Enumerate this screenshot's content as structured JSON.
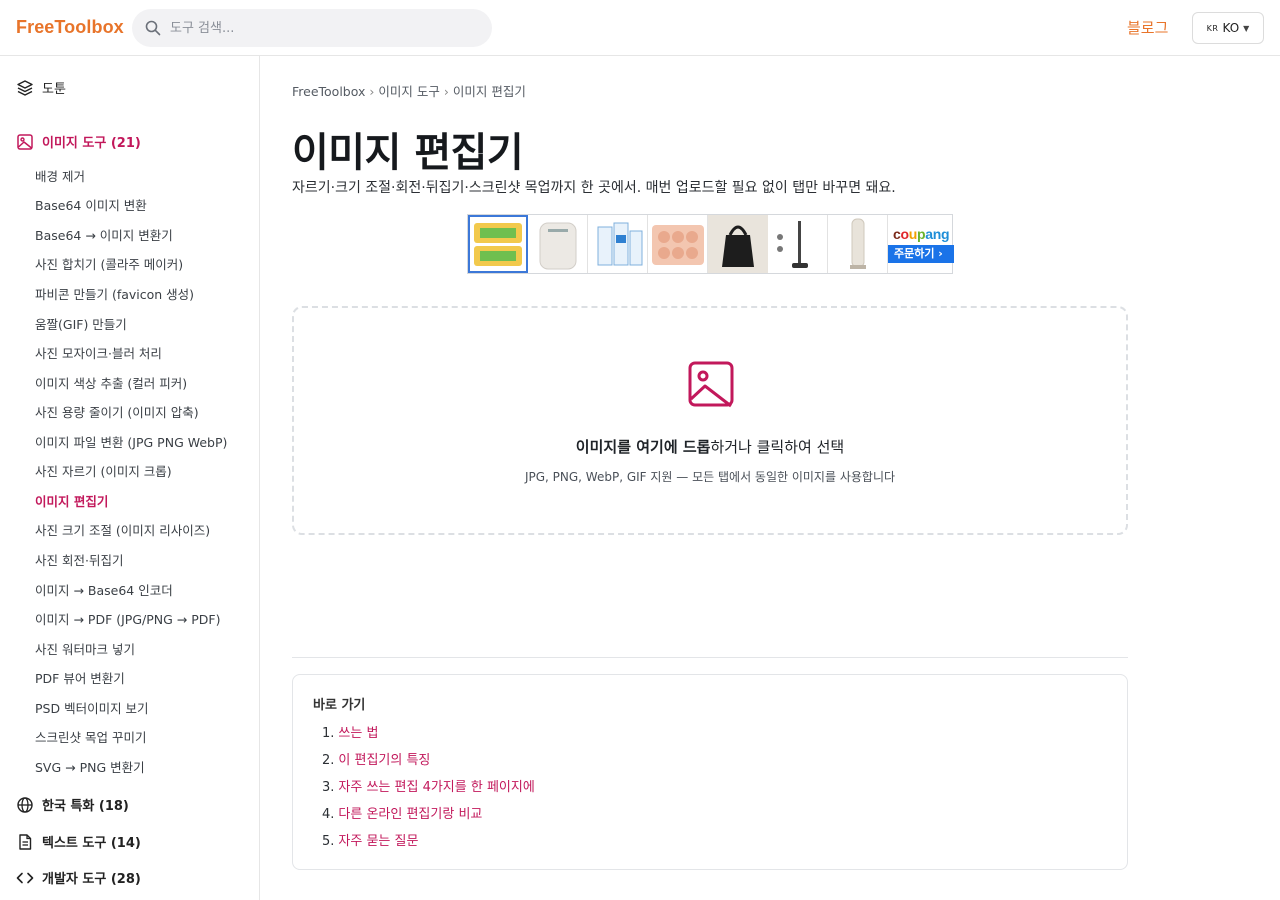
{
  "header": {
    "brand": "FreeToolbox",
    "search_placeholder": "도구 검색...",
    "blog_label": "블로그",
    "lang_flag": "KR",
    "lang_label": "KO"
  },
  "sidebar": {
    "top_item": "도툰",
    "categories": {
      "image": "이미지 도구 (21)",
      "korea": "한국 특화 (18)",
      "text": "텍스트 도구 (14)",
      "dev": "개발자 도구 (28)"
    },
    "image_items": [
      "배경 제거",
      "Base64 이미지 변환",
      "Base64 → 이미지 변환기",
      "사진 합치기 (콜라주 메이커)",
      "파비콘 만들기 (favicon 생성)",
      "움짤(GIF) 만들기",
      "사진 모자이크·블러 처리",
      "이미지 색상 추출 (컬러 피커)",
      "사진 용량 줄이기 (이미지 압축)",
      "이미지 파일 변환 (JPG PNG WebP)",
      "사진 자르기 (이미지 크롭)",
      "이미지 편집기",
      "사진 크기 조절 (이미지 리사이즈)",
      "사진 회전·뒤집기",
      "이미지 → Base64 인코더",
      "이미지 → PDF (JPG/PNG → PDF)",
      "사진 워터마크 넣기",
      "PDF 뷰어 변환기",
      "PSD 벡터이미지 보기",
      "스크린샷 목업 꾸미기",
      "SVG → PNG 변환기"
    ],
    "active_item": "이미지 편집기"
  },
  "breadcrumb": {
    "home": "FreeToolbox",
    "section": "이미지 도구",
    "current": "이미지 편집기",
    "separator": "›"
  },
  "main": {
    "title": "이미지 편집기",
    "subtitle": "자르기·크기 조절·회전·뒤집기·스크린샷 목업까지 한 곳에서. 매번 업로드할 필요 없이 탭만 바꾸면 돼요."
  },
  "ad": {
    "brand_parts": [
      "c",
      "o",
      "u",
      "p",
      "ang"
    ],
    "order_label": "주문하기 ›"
  },
  "dropzone": {
    "title_bold": "이미지를 여기에 드롭",
    "title_rest": "하거나 클릭하여 선택",
    "subtitle": "JPG, PNG, WebP, GIF 지원 — 모든 탭에서 동일한 이미지를 사용합니다"
  },
  "toc": {
    "title": "바로 가기",
    "items": [
      {
        "num": "1.",
        "label": "쓰는 법"
      },
      {
        "num": "2.",
        "label": "이 편집기의 특징"
      },
      {
        "num": "3.",
        "label": "자주 쓰는 편집 4가지를 한 페이지에"
      },
      {
        "num": "4.",
        "label": "다른 온라인 편집기랑 비교"
      },
      {
        "num": "5.",
        "label": "자주 묻는 질문"
      }
    ]
  },
  "colors": {
    "brand": "#e8742a",
    "accent": "#c2185b",
    "border": "#e6e6e6"
  },
  "icons": {
    "search": "search-icon",
    "layers": "layers-icon",
    "image": "image-icon",
    "globe": "globe-icon",
    "document": "document-icon",
    "code": "code-icon",
    "caret": "caret-down-icon"
  }
}
